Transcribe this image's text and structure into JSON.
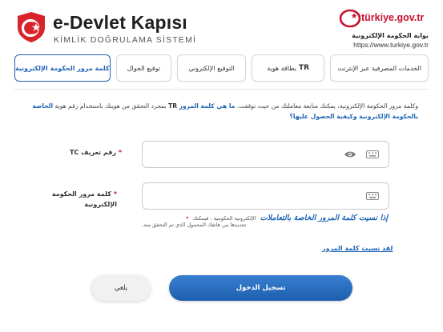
{
  "header": {
    "brand_title": "e-Devlet Kapısı",
    "brand_subtitle": "KİMLİK DOĞRULAMA SİSTEMİ",
    "gov_logo_text": "türkiye.gov.tr",
    "gov_arabic": "بوابة الحكومة الإلكترونية",
    "gov_url": "https://www.turkiye.gov.tr"
  },
  "tabs": [
    {
      "label": "كلمة مرور الحكومة الإلكترونية",
      "active": true
    },
    {
      "label": "توقيع الجوال",
      "active": false
    },
    {
      "label": "التوقيع الإلكتروني",
      "active": false
    },
    {
      "prefix": "TR",
      "label": "بطاقة هوية",
      "active": false
    },
    {
      "label": "الخدمات المصرفية عبر الإنترنت",
      "active": false
    }
  ],
  "description": {
    "part1": "وكلمة مرور الحكومة الإلكترونية، يمكنك متابعة معاملتك من حيث توقفت.",
    "link1": "ما هي كلمة المرور",
    "tr": "TR",
    "part2": "بمجرد التحقق من هويتك باستخدام رقم هوية",
    "link2": "الخاصة بالحكومة الإلكترونية وكيفية الحصول عليها؟"
  },
  "fields": {
    "tc": {
      "star": "*",
      "label": "رقم تعريف",
      "label_prefix": "TC"
    },
    "password": {
      "star": "*",
      "label": "كلمة مرور الحكومة الإلكترونية"
    }
  },
  "hint": {
    "star": "*",
    "big": "إذا نسيت كلمة المرور الخاصة بالتعاملات",
    "line1": "الإلكترونية الحكومية ، فيمكنك",
    "line2": "تجديدها من هاتفك المحمول الذي تم التحقق منه."
  },
  "forgot_link": "لقد نسيت كلمة المرور",
  "buttons": {
    "login": "تسجيل الدخول",
    "cancel": "يلغي"
  },
  "colors": {
    "accent": "#1e63b5",
    "brand_red": "#c8102e"
  }
}
